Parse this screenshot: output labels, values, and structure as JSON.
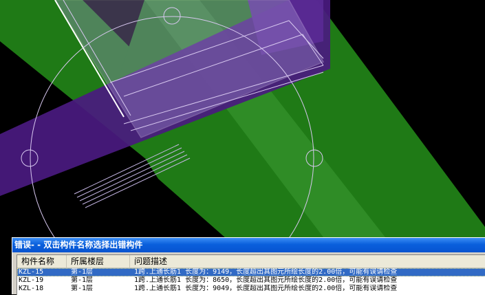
{
  "canvas": {
    "background": "#000000",
    "beam_green": "#1f7a16",
    "beam_purple": "#4a1a80",
    "outline_color": "#d8c8f0"
  },
  "error_panel": {
    "title": "错误- - 双击构件名称选择出错构件",
    "columns": [
      "构件名称",
      "所属楼层",
      "问题描述"
    ],
    "rows": [
      {
        "name": "KZL-15",
        "floor": "第-1层",
        "desc": "1跨.上通长筋1 长度为：9149，长度超出其图元所绘长度的2.00倍，可能有误请检查",
        "selected": true
      },
      {
        "name": "KZL-19",
        "floor": "第-1层",
        "desc": "1跨.上通长筋1 长度为：8650，长度超出其图元所绘长度的2.00倍，可能有误请检查",
        "selected": false
      },
      {
        "name": "KZL-18",
        "floor": "第-1层",
        "desc": "1跨.上通长筋1 长度为：9049，长度超出其图元所绘长度的2.00倍，可能有误请检查",
        "selected": false
      }
    ]
  }
}
